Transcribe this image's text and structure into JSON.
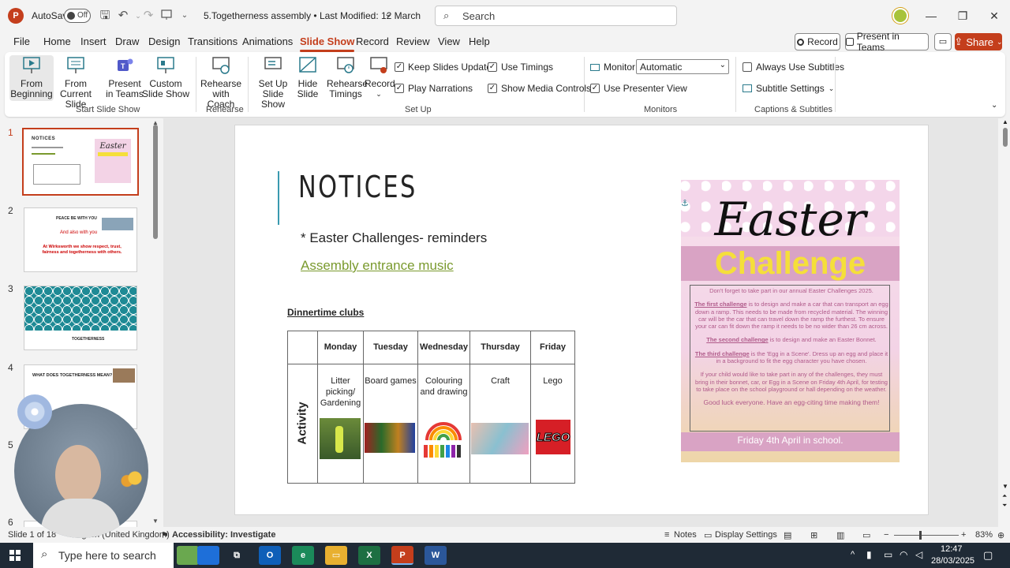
{
  "titlebar": {
    "autosave_label": "AutoSave",
    "autosave_state": "Off",
    "doc_title": "5.Togetherness assembly • Last Modified: 12 March",
    "search_placeholder": "Search"
  },
  "menu": {
    "tabs": [
      "File",
      "Home",
      "Insert",
      "Draw",
      "Design",
      "Transitions",
      "Animations",
      "Slide Show",
      "Record",
      "Review",
      "View",
      "Help"
    ],
    "active": "Slide Show",
    "record_label": "Record",
    "present_teams_label": "Present in Teams",
    "share_label": "Share"
  },
  "ribbon": {
    "start": {
      "from_beginning": "From Beginning",
      "from_current": "From Current Slide",
      "present_teams": "Present in Teams",
      "custom": "Custom Slide Show",
      "group_label": "Start Slide Show"
    },
    "rehearse": {
      "coach": "Rehearse with Coach",
      "group_label": "Rehearse"
    },
    "setup": {
      "setup_show": "Set Up Slide Show",
      "hide_slide": "Hide Slide",
      "rehearse_timings": "Rehearse Timings",
      "record": "Record",
      "keep_updated": "Keep Slides Updated",
      "use_timings": "Use Timings",
      "play_narrations": "Play Narrations",
      "show_media": "Show Media Controls",
      "group_label": "Set Up"
    },
    "monitors": {
      "monitor_label": "Monitor:",
      "monitor_value": "Automatic",
      "use_presenter": "Use Presenter View",
      "group_label": "Monitors"
    },
    "captions": {
      "always_subtitles": "Always Use Subtitles",
      "subtitle_settings": "Subtitle Settings",
      "group_label": "Captions & Subtitles"
    }
  },
  "thumbs": {
    "numbers": [
      "1",
      "2",
      "3",
      "4",
      "5",
      "6"
    ],
    "t1_title": "NOTICES",
    "t1_sub": "Easter",
    "t2_line1": "PEACE BE WITH YOU",
    "t2_line2": "And also with you",
    "t2_line3": "At Wirksworth we show respect, trust, fairness and togetherness with others.",
    "t3_text": "TOGETHERNESS",
    "t4_title": "WHAT DOES TOGETHERNESS MEAN?"
  },
  "slide": {
    "title": "NOTICES",
    "bullet1": "* Easter Challenges- reminders",
    "link": "Assembly entrance music",
    "clubs_title": "Dinnertime clubs",
    "row_label": "Activity",
    "days": [
      "Monday",
      "Tuesday",
      "Wednesday",
      "Thursday",
      "Friday"
    ],
    "activities": [
      "Litter picking/ Gardening",
      "Board games",
      "Colouring and drawing",
      "Craft",
      "Lego"
    ],
    "lego_text": "LEGO",
    "poster": {
      "title1": "Easter",
      "title2": "Challenge",
      "p0": "Don't forget to take part in our annual Easter Challenges 2025.",
      "c1_head": "The first challenge",
      "c1_body": " is to design and make a car that can transport an egg down a ramp. This needs to be made from recycled material.  The winning car will be the car that can travel down the ramp the furthest. To ensure your car can fit down the ramp it needs to be no wider than 26 cm across.",
      "c2_head": "The second challenge",
      "c2_body": " is to design and make an Easter Bonnet.",
      "c3_head": "The third challenge",
      "c3_body": " is the 'Egg in a Scene'. Dress up an egg and place it in a background to fit the egg character you have chosen.",
      "p4": "If your child would like to take part in any of the challenges, they must bring in their bonnet, car, or Egg in a Scene on Friday 4th April, for testing to take place on the school playground or hall depending on the weather.",
      "p5": "Good luck everyone. Have an egg-citing time making them!",
      "footer": "Friday 4th April in school."
    }
  },
  "status": {
    "slide_of": "Slide 1 of 18",
    "language": "English (United Kingdom)",
    "accessibility": "Accessibility: Investigate",
    "notes": "Notes",
    "display_settings": "Display Settings",
    "zoom": "83%"
  },
  "taskbar": {
    "search_placeholder": "Type here to search",
    "time": "12:47",
    "date": "28/03/2025"
  },
  "colors": {
    "accent": "#c43e1c",
    "link_green": "#7a9a2e",
    "poster_pink": "#f3d3e6",
    "poster_yellow": "#f5df3a"
  }
}
